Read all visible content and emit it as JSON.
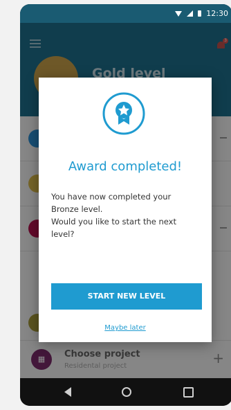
{
  "status_bar": {
    "time": "12:30"
  },
  "header": {
    "level_title": "Gold level",
    "notification_count": "3"
  },
  "list_rows": [
    {
      "color": "#2b8fd4"
    },
    {
      "color": "#d8b84a"
    },
    {
      "color": "#b4124e"
    },
    {
      "color": "#a69a3a"
    }
  ],
  "project": {
    "icon_text": "▦",
    "name": "Choose project",
    "subtitle": "Residental project",
    "add_label": "+"
  },
  "dialog": {
    "title": "Award completed!",
    "message": "You have now completed your\nBronze level.\nWould you like to start the next\nlevel?",
    "start_button": "START NEW LEVEL",
    "later_link": "Maybe later"
  },
  "colors": {
    "accent": "#1f9bd0",
    "header": "#1e6f8d"
  }
}
